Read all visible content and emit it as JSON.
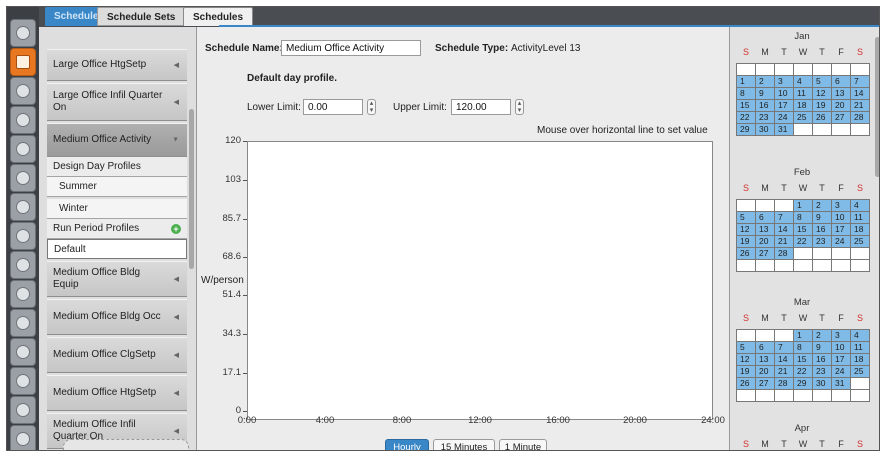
{
  "top_tabs": {
    "schedules": "Schedules",
    "schedule_sets": "Schedule Sets",
    "right_tab": "Schedules"
  },
  "icon_bar": {
    "icons": [
      "site-icon",
      "schedules-icon",
      "constructions-icon",
      "loads-icon",
      "space-types-icon",
      "geometry-icon",
      "facility-icon",
      "spaces-icon",
      "thermal-zones-icon",
      "hvac-systems-icon",
      "variables-icon",
      "simulation-settings-icon",
      "measures-icon",
      "run-icon",
      "results-icon"
    ],
    "active_index": 1,
    "active_color": "#e87722"
  },
  "sidebar": {
    "items": [
      {
        "label": "Large Office HtgSetp"
      },
      {
        "label": "Large Office Infil Quarter On"
      },
      {
        "label": "Medium Office Activity",
        "selected": true
      },
      {
        "label": "Medium Office Bldg Equip"
      },
      {
        "label": "Medium Office Bldg Occ"
      },
      {
        "label": "Medium Office ClgSetp"
      },
      {
        "label": "Medium Office HtgSetp"
      },
      {
        "label": "Medium Office Infil Quarter On"
      }
    ],
    "design_day_header": "Design Day Profiles",
    "design_days": [
      "Summer",
      "Winter"
    ],
    "run_period_header": "Run Period Profiles",
    "run_period_items": [
      "Default"
    ]
  },
  "main": {
    "schedule_name_label": "Schedule Name:",
    "schedule_name_value": "Medium Office Activity",
    "schedule_type_label": "Schedule Type:",
    "schedule_type_value": "ActivityLevel 13",
    "profile_title": "Default day profile.",
    "lower_limit_label": "Lower Limit:",
    "lower_limit_value": "0.00",
    "upper_limit_label": "Upper Limit:",
    "upper_limit_value": "120.00",
    "hint": "Mouse over horizontal line to set value",
    "y_unit": "W/person",
    "y_ticks": [
      "120",
      "103",
      "85.7",
      "68.6",
      "51.4",
      "34.3",
      "17.1",
      "0"
    ],
    "x_ticks": [
      "0:00",
      "4:00",
      "8:00",
      "12:00",
      "16:00",
      "20:00",
      "24:00"
    ],
    "buttons": {
      "hourly": "Hourly",
      "fifteen": "15 Minutes",
      "one": "1 Minute"
    },
    "accent": "#3a87c8"
  },
  "calendar": {
    "dow": [
      "S",
      "M",
      "T",
      "W",
      "T",
      "F",
      "S"
    ],
    "months": [
      {
        "name": "Jan",
        "weeks": [
          [
            "",
            "",
            "",
            "",
            "",
            "",
            ""
          ],
          [
            "1",
            "2",
            "3",
            "4",
            "5",
            "6",
            "7"
          ],
          [
            "8",
            "9",
            "10",
            "11",
            "12",
            "13",
            "14"
          ],
          [
            "15",
            "16",
            "17",
            "18",
            "19",
            "20",
            "21"
          ],
          [
            "22",
            "23",
            "24",
            "25",
            "26",
            "27",
            "28"
          ],
          [
            "29",
            "30",
            "31",
            "",
            "",
            "",
            ""
          ]
        ]
      },
      {
        "name": "Feb",
        "weeks": [
          [
            "",
            "",
            "",
            "1",
            "2",
            "3",
            "4"
          ],
          [
            "5",
            "6",
            "7",
            "8",
            "9",
            "10",
            "11"
          ],
          [
            "12",
            "13",
            "14",
            "15",
            "16",
            "17",
            "18"
          ],
          [
            "19",
            "20",
            "21",
            "22",
            "23",
            "24",
            "25"
          ],
          [
            "26",
            "27",
            "28",
            "",
            "",
            "",
            ""
          ],
          [
            "",
            "",
            "",
            "",
            "",
            "",
            ""
          ]
        ]
      },
      {
        "name": "Mar",
        "weeks": [
          [
            "",
            "",
            "",
            "1",
            "2",
            "3",
            "4"
          ],
          [
            "5",
            "6",
            "7",
            "8",
            "9",
            "10",
            "11"
          ],
          [
            "12",
            "13",
            "14",
            "15",
            "16",
            "17",
            "18"
          ],
          [
            "19",
            "20",
            "21",
            "22",
            "23",
            "24",
            "25"
          ],
          [
            "26",
            "27",
            "28",
            "29",
            "30",
            "31",
            ""
          ],
          [
            "",
            "",
            "",
            "",
            "",
            "",
            ""
          ]
        ]
      },
      {
        "name": "Apr",
        "weeks": []
      }
    ],
    "fill_color": "#7fbbe6"
  }
}
